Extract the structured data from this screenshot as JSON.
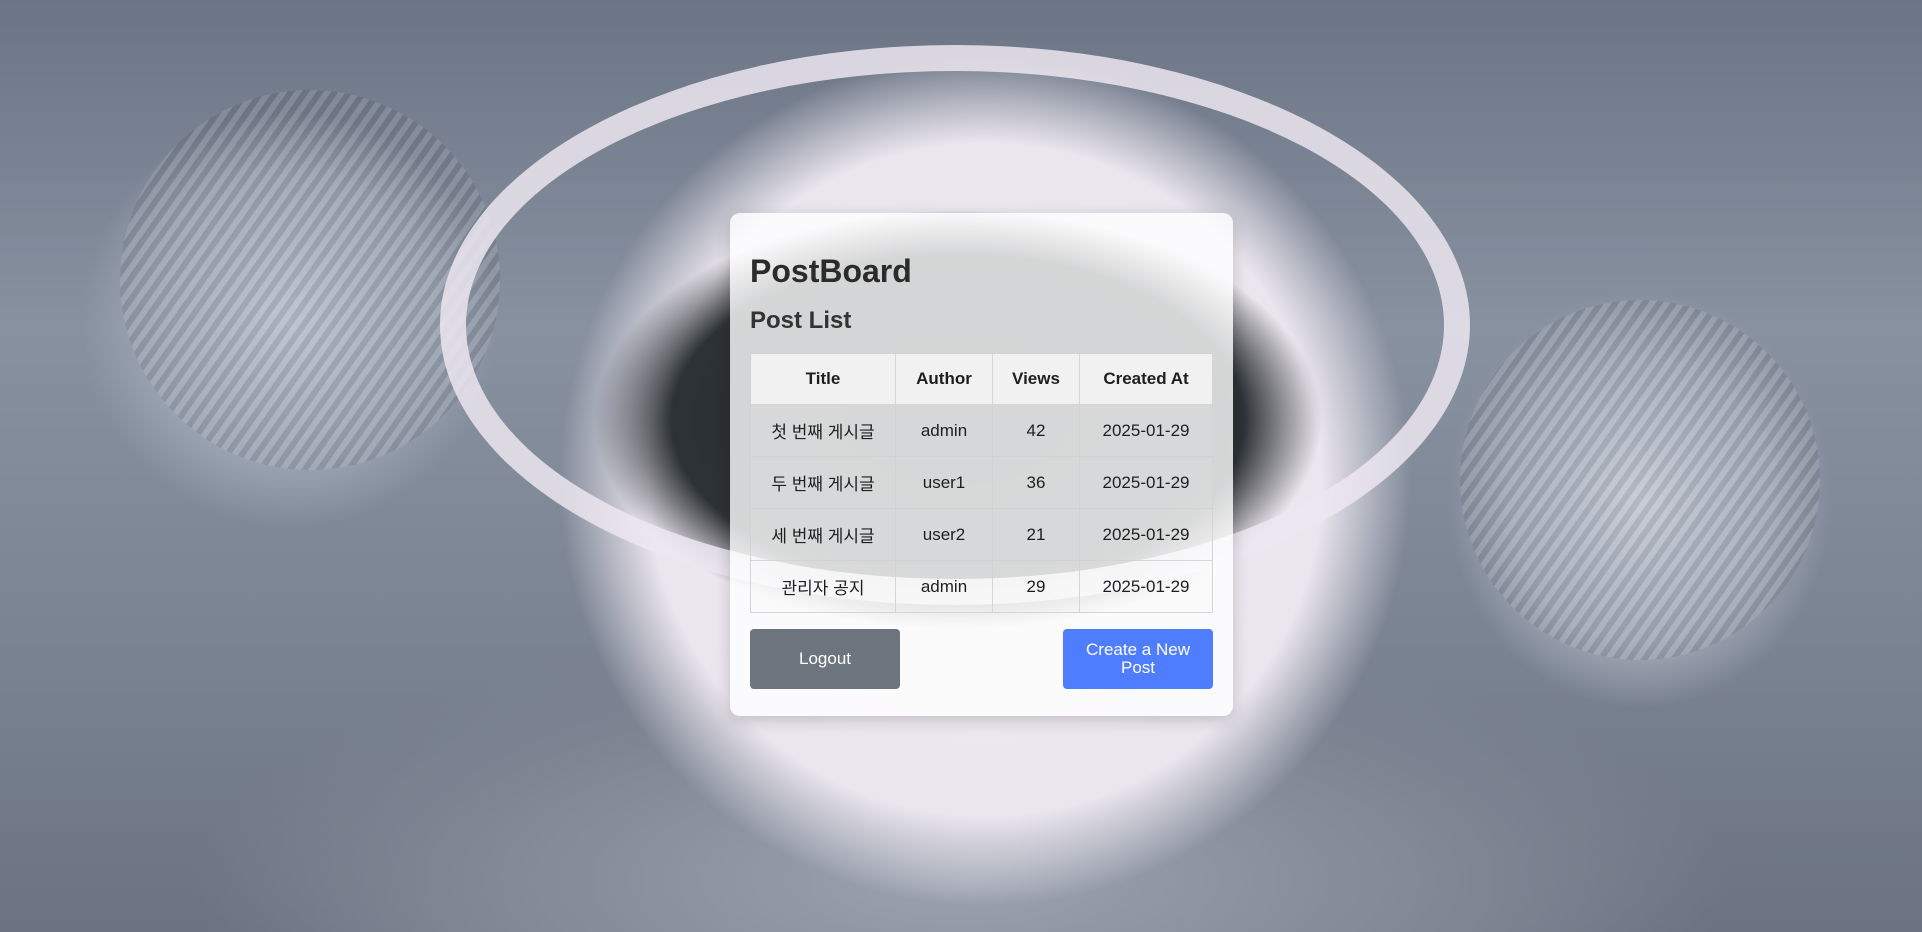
{
  "app": {
    "brand": "PostBoard",
    "subtitle": "Post List"
  },
  "table": {
    "headers": [
      "Title",
      "Author",
      "Views",
      "Created At"
    ],
    "rows": [
      {
        "title": "첫 번째 게시글",
        "author": "admin",
        "views": "42",
        "created_at": "2025-01-29"
      },
      {
        "title": "두 번째 게시글",
        "author": "user1",
        "views": "36",
        "created_at": "2025-01-29"
      },
      {
        "title": "세 번째 게시글",
        "author": "user2",
        "views": "21",
        "created_at": "2025-01-29"
      },
      {
        "title": "관리자 공지",
        "author": "admin",
        "views": "29",
        "created_at": "2025-01-29"
      }
    ]
  },
  "actions": {
    "logout_label": "Logout",
    "create_label": "Create a New Post"
  },
  "colors": {
    "logout_button": "#6c757d",
    "create_button": "#4f7dff"
  }
}
